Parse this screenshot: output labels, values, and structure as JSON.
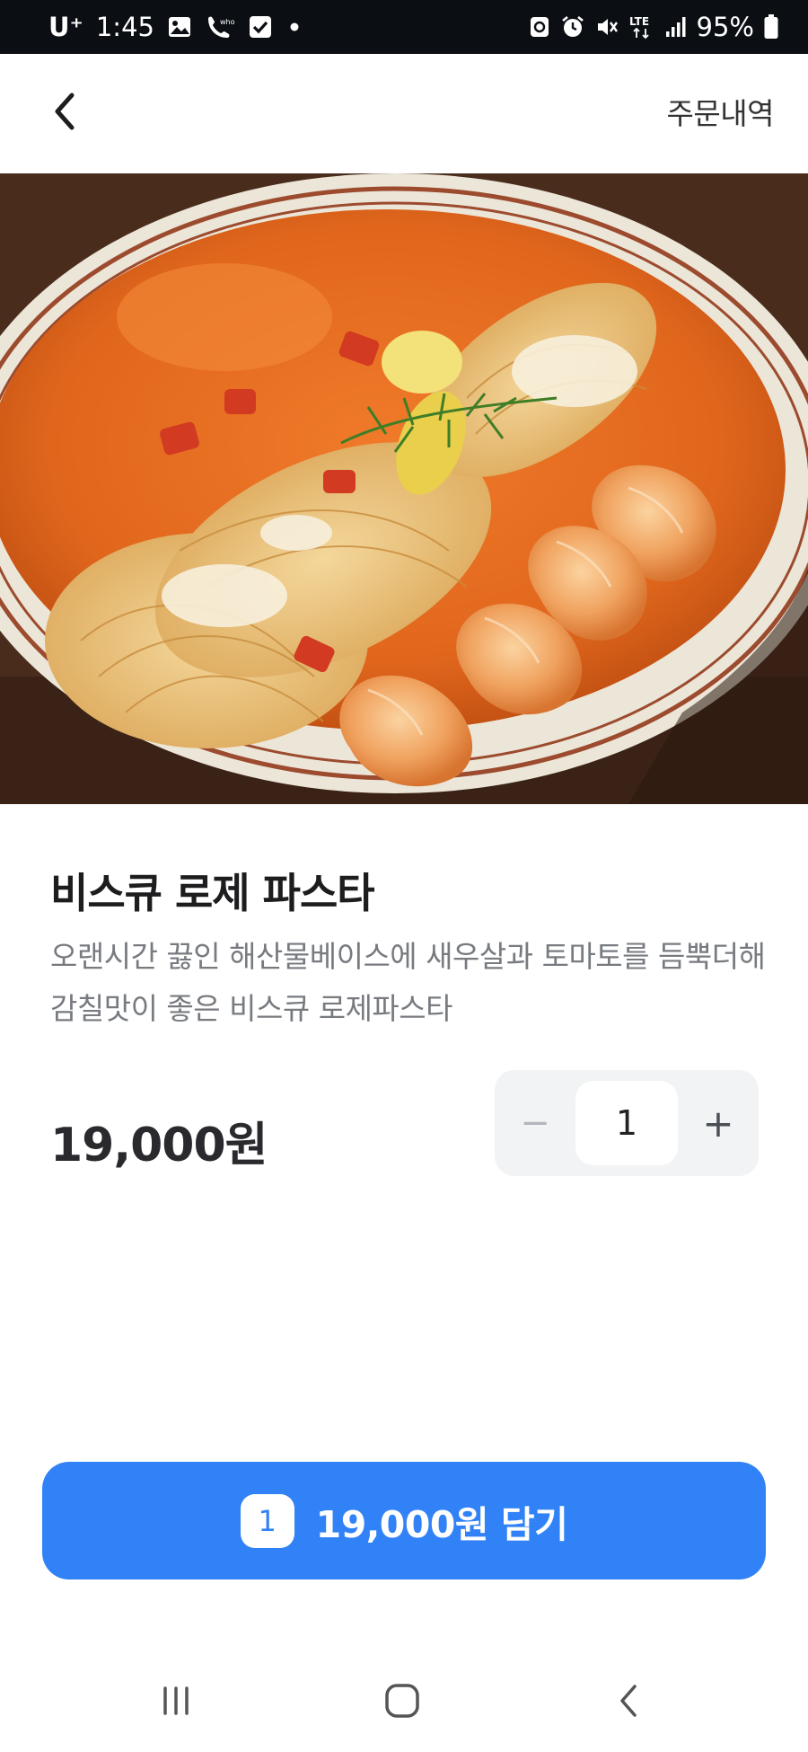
{
  "status_bar": {
    "carrier": "U⁺",
    "time": "1:45",
    "battery": "95%",
    "left_icons": [
      "gallery-icon",
      "whowho-call-icon",
      "checkbox-icon",
      "dot-icon"
    ],
    "right_icons": [
      "recycle-icon",
      "alarm-icon",
      "mute-icon",
      "lte-icon",
      "signal-icon",
      "battery-icon"
    ]
  },
  "header": {
    "back_icon": "chevron-left-icon",
    "order_history": "주문내역"
  },
  "hero": {
    "image": "shrimp rose pasta photo"
  },
  "product": {
    "name": "비스큐 로제 파스타",
    "description": "오랜시간 끓인 해산물베이스에 새우살과 토마토를 듬뿍더해 감칠맛이 좋은 비스큐 로제파스타",
    "price": "19,000원"
  },
  "stepper": {
    "minus": "−",
    "value": "1",
    "plus": "+"
  },
  "cta": {
    "badge": "1",
    "label": "19,000원 담기"
  },
  "nav": {
    "recent_icon": "recent-apps-icon",
    "home_icon": "home-icon",
    "back_icon": "back-icon"
  },
  "colors": {
    "accent": "#3182f6",
    "status_bar_bg": "#0b0f14",
    "stepper_bg": "#f2f3f5",
    "text_secondary": "#777b80"
  }
}
